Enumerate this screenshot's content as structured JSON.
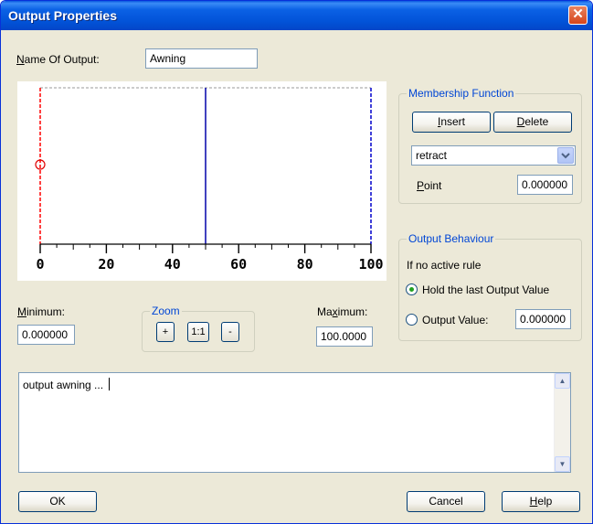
{
  "window": {
    "title": "Output Properties"
  },
  "name_of_output": {
    "label_pre": "",
    "label_accel": "N",
    "label_post": "ame Of Output:",
    "value": "Awning"
  },
  "plot": {
    "x_ticks": [
      "0",
      "20",
      "40",
      "60",
      "80",
      "100"
    ],
    "xlim": [
      0,
      100
    ],
    "membership_line_x": 50
  },
  "minimum": {
    "label_accel": "M",
    "label_post": "inimum:",
    "value": "0.000000"
  },
  "maximum": {
    "label_pre": "Ma",
    "label_accel": "x",
    "label_post": "imum:",
    "value": "100.0000"
  },
  "zoom": {
    "title": "Zoom",
    "zoom_in": "+",
    "reset": "1:1",
    "zoom_out": "-"
  },
  "membership": {
    "title": "Membership Function",
    "insert_accel": "I",
    "insert_post": "nsert",
    "delete_accel": "D",
    "delete_post": "elete",
    "selected_function": "retract",
    "point_accel": "P",
    "point_post": "oint",
    "point_value": "0.000000"
  },
  "behaviour": {
    "title": "Output Behaviour",
    "caption": "If no active rule",
    "hold_label": "Hold the last Output Value",
    "value_label": "Output Value:",
    "value": "0.000000"
  },
  "editor": {
    "text": "output awning ..."
  },
  "buttons": {
    "ok": "OK",
    "cancel": "Cancel",
    "help_accel": "H",
    "help_post": "elp"
  },
  "colors": {
    "accent": "#0046d5",
    "titlebar": "#0253d8",
    "point_marker": "#e00000"
  }
}
